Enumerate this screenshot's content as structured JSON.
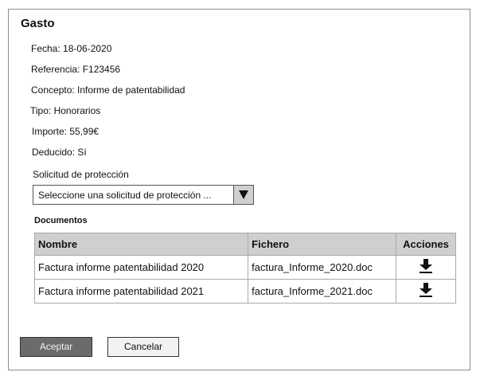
{
  "dialog": {
    "title": "Gasto"
  },
  "fields": [
    {
      "text": "Fecha: 18-06-2020"
    },
    {
      "text": "Referencia: F123456"
    },
    {
      "text": "Concepto: Informe de patentabilidad"
    },
    {
      "text": "Tipo: Honorarios"
    },
    {
      "text": "Importe: 55,99€"
    },
    {
      "text": "Deducido: Sí"
    }
  ],
  "solicitud": {
    "label": "Solicitud de protección",
    "selected": "Seleccione una solicitud de protección ..."
  },
  "documents": {
    "heading": "Documentos",
    "columns": [
      "Nombre",
      "Fichero",
      "Acciones"
    ],
    "rows": [
      {
        "nombre": "Factura informe patentabilidad 2020",
        "fichero": "factura_Informe_2020.doc",
        "action_icon": "download-icon"
      },
      {
        "nombre": "Factura informe patentabilidad 2021",
        "fichero": "factura_Informe_2021.doc",
        "action_icon": "download-icon"
      }
    ]
  },
  "buttons": {
    "accept": "Aceptar",
    "cancel": "Cancelar"
  },
  "colors": {
    "header_bg": "#cfcfcf",
    "accept_bg": "#6b6b6b"
  }
}
